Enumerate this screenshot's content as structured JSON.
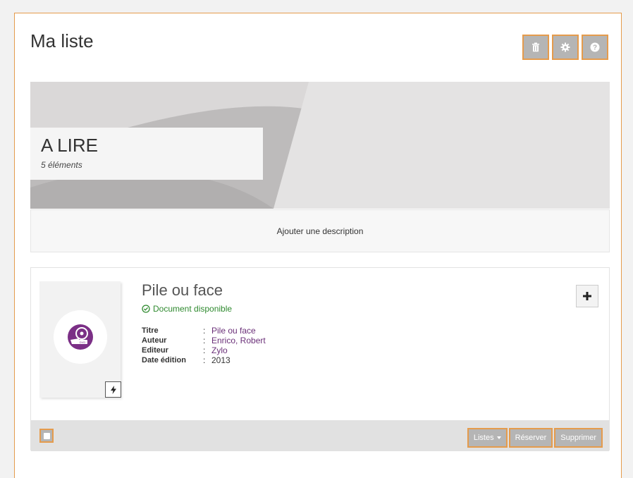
{
  "page": {
    "title": "Ma liste"
  },
  "header_buttons": [
    {
      "icon": "trash-icon"
    },
    {
      "icon": "gear-icon"
    },
    {
      "icon": "help-icon"
    }
  ],
  "banner": {
    "title": "A LIRE",
    "count": "5 éléments"
  },
  "description": {
    "label": "Ajouter une description"
  },
  "document": {
    "title": "Pile ou face",
    "availability": "Document disponible",
    "icon": "dvd-icon",
    "fields": [
      {
        "key": "Titre",
        "value": "Pile ou face"
      },
      {
        "key": "Auteur",
        "value": "Enrico, Robert"
      },
      {
        "key": "Editeur",
        "value": "Zylo"
      },
      {
        "key": "Date édition",
        "value": "2013"
      }
    ],
    "separator": ":",
    "add_icon": "plus-icon",
    "quick_icon": "bolt-icon"
  },
  "footer": {
    "lists_label": "Listes",
    "reserve_label": "Réserver",
    "delete_label": "Supprimer"
  },
  "colors": {
    "accent_border": "#e59b4c",
    "button_gray": "#b5b5b5",
    "link_purple": "#6a2f78",
    "available_green": "#2f8a2f"
  }
}
